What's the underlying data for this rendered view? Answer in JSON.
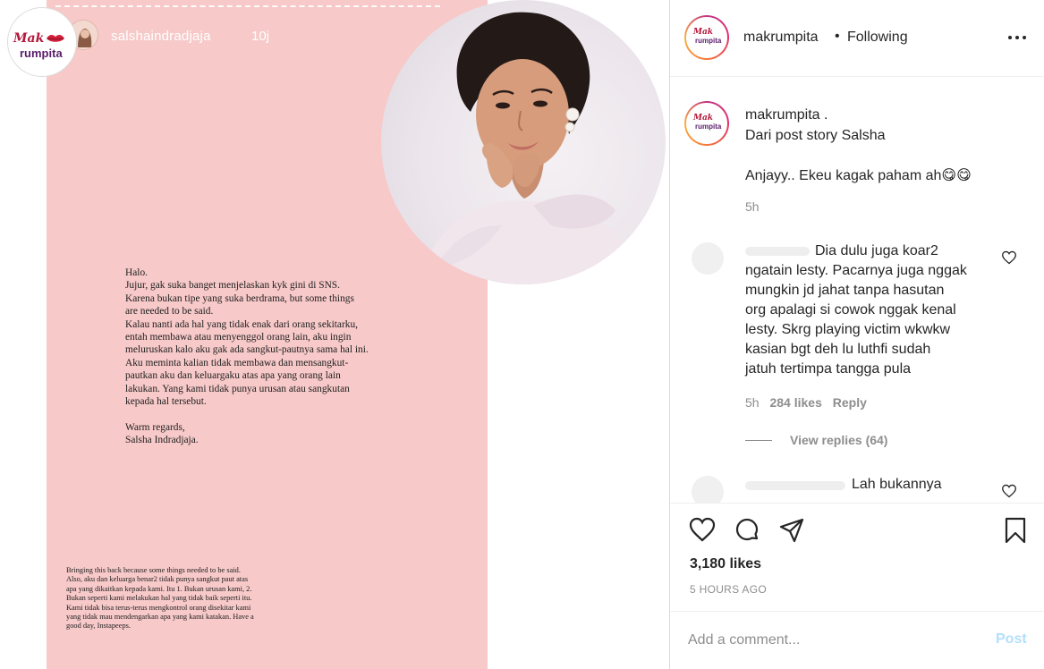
{
  "story": {
    "username": "salshaindradjaja",
    "time": "10j",
    "letter_lines": [
      "Halo.",
      "Jujur, gak suka banget menjelaskan kyk gini di SNS.",
      "Karena bukan tipe yang suka berdrama, but some things",
      "are needed to be said.",
      "Kalau nanti ada hal yang tidak enak dari orang sekitarku,",
      "entah membawa atau menyenggol orang lain, aku ingin",
      "meluruskan kalo aku gak ada sangkut-pautnya sama hal ini.",
      "Aku meminta kalian tidak membawa dan mensangkut-",
      "pautkan aku dan keluargaku atas apa yang orang lain",
      "lakukan. Yang kami tidak punya urusan atau sangkutan",
      "kepada hal tersebut.",
      "",
      "Warm regards,",
      "Salsha Indradjaja."
    ],
    "note_lines": [
      "Bringing this back because some things needed to be said.",
      "Also, aku dan keluarga benar2 tidak punya sangkut paut atas",
      "apa yang dikaitkan kepada kami. Itu 1. Bukan urusan kami, 2.",
      "Bukan seperti kami melakukan hal yang tidak baik seperti itu.",
      "Kami tidak bisa terus-terus mengkontrol orang disekitar kami",
      "yang tidak mau mendengarkan apa yang kami katakan. Have a",
      "good day, Instapeeps."
    ]
  },
  "brand": {
    "line1": "Mak",
    "line2": "rumpita"
  },
  "header": {
    "username": "makrumpita",
    "separator": "•",
    "follow_status": "Following"
  },
  "caption": {
    "username": "makrumpita",
    "username_suffix": " .",
    "line1": "Dari post story Salsha",
    "line2": "Anjayy.. Ekeu kagak paham ah😋😋",
    "time": "5h"
  },
  "comments": [
    {
      "lines": [
        "Dia dulu juga koar2",
        "ngatain lesty. Pacarnya juga nggak",
        "mungkin jd jahat tanpa hasutan",
        "org apalagi si cowok nggak kenal",
        "lesty. Skrg playing victim wkwkw",
        "kasian bgt deh lu luthfi sudah",
        "jatuh tertimpa tangga pula"
      ],
      "time": "5h",
      "likes": "284 likes",
      "reply_label": "Reply",
      "view_replies": "View replies (64)"
    },
    {
      "text": "Lah bukannya"
    }
  ],
  "actions": {
    "likes": "3,180 likes",
    "timestamp": "5 HOURS AGO"
  },
  "comment_box": {
    "placeholder": "Add a comment...",
    "post_label": "Post"
  },
  "colors": {
    "story_background": "#f7c9c9",
    "post_button": "#b2dffc",
    "brand_red": "#b5173a",
    "brand_purple": "#5a1c6b",
    "muted_text": "#8e8e8e"
  },
  "icons": [
    "heart-icon",
    "comment-icon",
    "share-icon",
    "save-icon",
    "more-icon",
    "like-icon"
  ]
}
